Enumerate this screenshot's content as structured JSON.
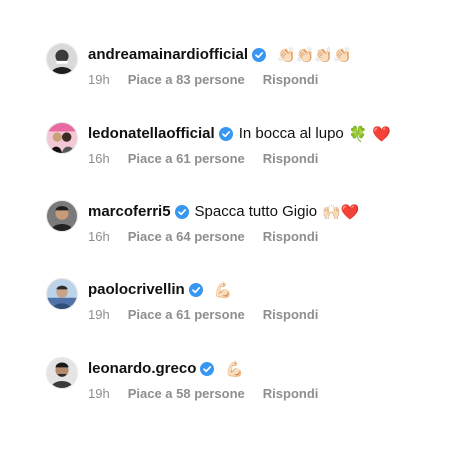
{
  "comments": [
    {
      "username": "andreamainardiofficial",
      "text": "",
      "emoji": "👏🏻👏🏻👏🏻👏🏻",
      "time": "19h",
      "likes": "Piace a 83 persone",
      "reply": "Rispondi",
      "avatar_color": "#3a3a3a"
    },
    {
      "username": "ledonatellaofficial",
      "text": "In bocca al lupo",
      "emoji": "🍀 ❤️",
      "time": "16h",
      "likes": "Piace a 61 persone",
      "reply": "Rispondi",
      "avatar_color": "#e8a0b8"
    },
    {
      "username": "marcoferri5",
      "text": "Spacca tutto Gigio",
      "emoji": "🙌🏻❤️",
      "time": "16h",
      "likes": "Piace a 64 persone",
      "reply": "Rispondi",
      "avatar_color": "#2d2d2d"
    },
    {
      "username": "paolocrivellin",
      "text": "",
      "emoji": "💪🏻",
      "time": "19h",
      "likes": "Piace a 61 persone",
      "reply": "Rispondi",
      "avatar_color": "#6e8fb8"
    },
    {
      "username": "leonardo.greco",
      "text": "",
      "emoji": "💪🏻",
      "time": "19h",
      "likes": "Piace a 58 persone",
      "reply": "Rispondi",
      "avatar_color": "#3b3b3b"
    }
  ],
  "colors": {
    "verified": "#3897f0",
    "meta": "#8e8e8e",
    "text": "#111111"
  },
  "icons": {
    "verified": "verified-badge-icon"
  }
}
